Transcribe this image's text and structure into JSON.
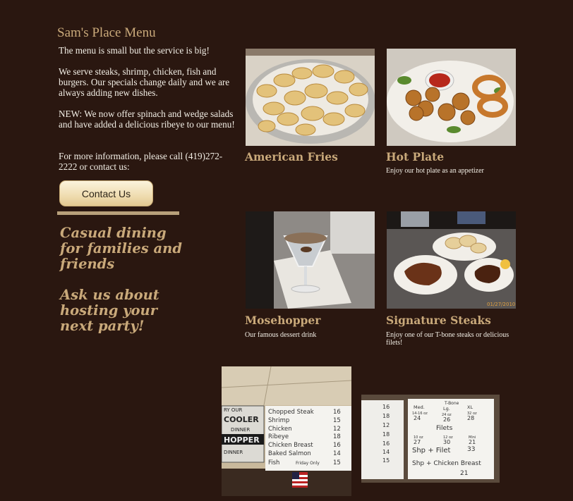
{
  "page": {
    "title": "Sam's Place Menu",
    "intro": "The menu is small but the service is big!",
    "serve": "We serve steaks, shrimp, chicken, fish and burgers. Our specials change daily and we are always adding new dishes.",
    "new_items": "NEW: We now offer spinach and wedge salads and have added a delicious ribeye to our menu!",
    "info": "For more information, please call (419)272-2222 or contact us:",
    "contact_button": "Contact Us",
    "slogan_1": "Casual dining for families and friends",
    "slogan_2": "Ask us about hosting your next party!"
  },
  "menu_items": [
    {
      "name": "American Fries",
      "description": ""
    },
    {
      "name": "Hot Plate",
      "description": "Enjoy our hot plate as an appetizer"
    },
    {
      "name": "Mosehopper",
      "description": "Our famous dessert drink"
    },
    {
      "name": "Signature Steaks",
      "description": "Enjoy one of our T-bone steaks or delicious filets!"
    }
  ],
  "board_left": {
    "sign_lines": [
      "RY OUR",
      "COOLER",
      "DINNER",
      "HOPPER",
      "DINNER"
    ],
    "items": [
      "Chopped Steak",
      "Shrimp",
      "Chicken",
      "Ribeye",
      "Chicken Breast",
      "Baked Salmon",
      "Fish"
    ],
    "note": "Friday Only",
    "prices": [
      "16",
      "15",
      "12",
      "18",
      "16",
      "14",
      "15"
    ]
  },
  "board_right": {
    "left_prices": [
      "16",
      "18",
      "12",
      "18",
      "16",
      "14",
      "15"
    ],
    "header": "T-Bone",
    "sizes": [
      "Med.",
      "Lg.",
      "XL"
    ],
    "size_weights": [
      "14-16 oz",
      "24 oz",
      "32 oz"
    ],
    "size_prices": [
      "24",
      "26",
      "28"
    ],
    "filets_label": "Filets",
    "filet_weights": [
      "10 oz",
      "12 oz",
      "Mini"
    ],
    "filet_prices": [
      "27",
      "30",
      "21"
    ],
    "combo_1": "Shp + Filet",
    "combo_1_price": "33",
    "combo_2": "Shp + Chicken Breast",
    "combo_2_price": "21"
  },
  "photo_date": "01/27/2010",
  "colors": {
    "background": "#2a1710",
    "accent": "#c9a97a",
    "text": "#f3efe6"
  }
}
